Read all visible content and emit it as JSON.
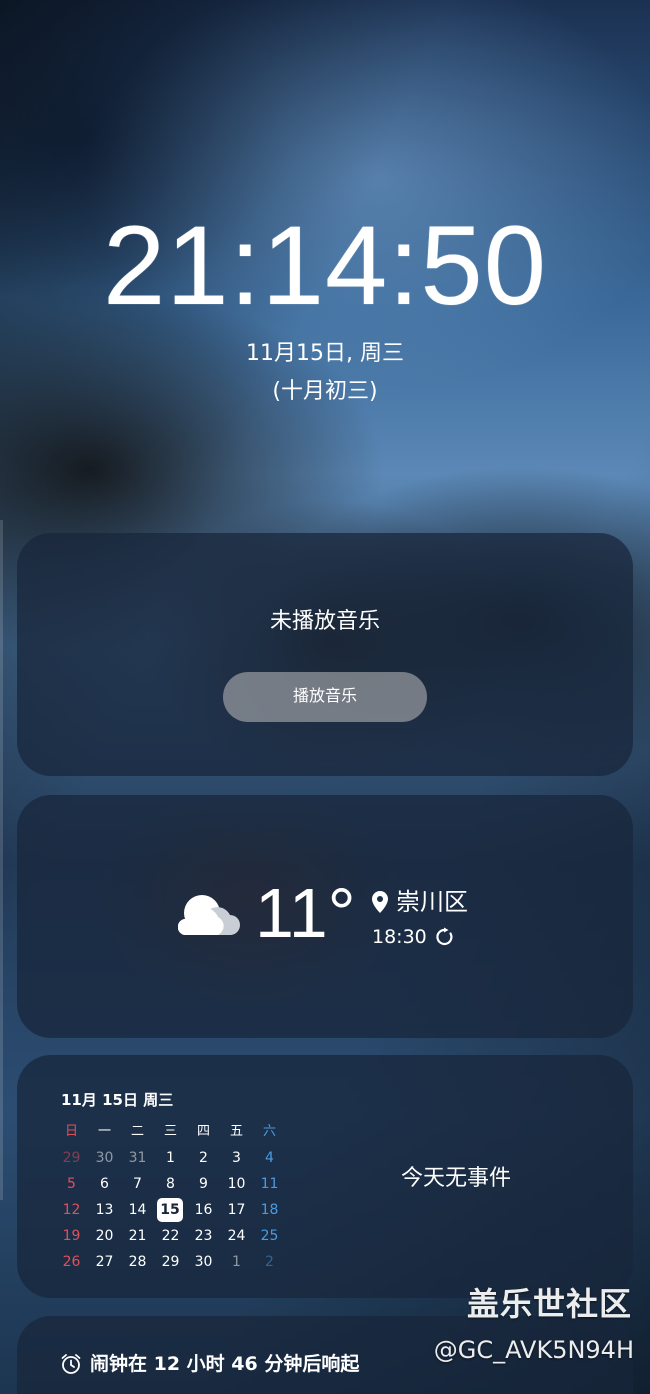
{
  "lockscreen": {
    "time": "21:14:50",
    "date": "11月15日, 周三",
    "lunar_date": "(十月初三)"
  },
  "music": {
    "status": "未播放音乐",
    "play_label": "播放音乐"
  },
  "weather": {
    "icon": "cloudy-icon",
    "temperature": "11°",
    "location": "崇川区",
    "updated_time": "18:30"
  },
  "calendar": {
    "header": "11月 15日 周三",
    "weekdays": [
      "日",
      "一",
      "二",
      "三",
      "四",
      "五",
      "六"
    ],
    "weeks": [
      [
        "29",
        "30",
        "31",
        "1",
        "2",
        "3",
        "4"
      ],
      [
        "5",
        "6",
        "7",
        "8",
        "9",
        "10",
        "11"
      ],
      [
        "12",
        "13",
        "14",
        "15",
        "16",
        "17",
        "18"
      ],
      [
        "19",
        "20",
        "21",
        "22",
        "23",
        "24",
        "25"
      ],
      [
        "26",
        "27",
        "28",
        "29",
        "30",
        "1",
        "2"
      ]
    ],
    "today": "15",
    "no_events": "今天无事件"
  },
  "alarm": {
    "text": "闹钟在 12 小时 46 分钟后响起"
  },
  "watermark": {
    "title": "盖乐世社区",
    "handle": "@GC_AVK5N94H"
  },
  "colors": {
    "sunday": "#e0505a",
    "saturday": "#4a9be0",
    "card_bg": "rgba(24,38,58,0.72)"
  }
}
